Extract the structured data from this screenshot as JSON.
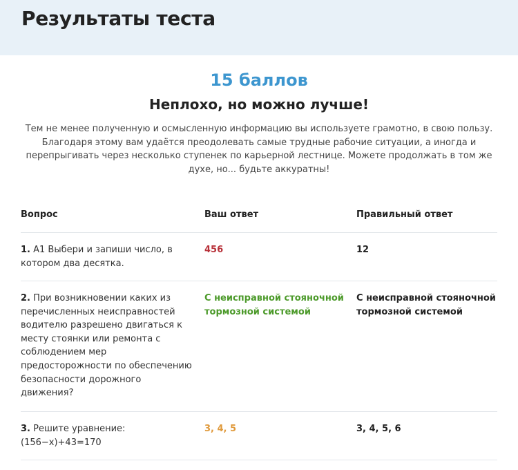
{
  "header": {
    "title": "Результаты теста",
    "bg_color": "#e8f1f8"
  },
  "result": {
    "score": "15 баллов",
    "verdict": "Неплохо, но можно лучше!",
    "description": "Тем не менее полученную и осмысленную информацию вы используете грамотно, в свою пользу. Благодаря этому вам удаётся преодолевать самые трудные рабочие ситуации, а иногда и перепрыгивать через несколько ступенек по карьерной лестнице. Можете продолжать в том же духе, но... будьте аккуратны!",
    "score_color": "#3d96cf"
  },
  "table": {
    "columns": [
      "Вопрос",
      "Ваш ответ",
      "Правильный ответ"
    ],
    "rows": [
      {
        "number": "1.",
        "question": "А1 Выбери и запиши число, в котором два десятка.",
        "your_answer": "456",
        "answer_status": "wrong",
        "correct_answer": "12"
      },
      {
        "number": "2.",
        "question": "При возникновении каких из перечисленных неисправностей водителю разрешено двигаться к месту стоянки или ремонта с соблюдением мер предосторожности по обеспечению безопасности дорожного движения?",
        "your_answer": "С неисправной стояночной тормозной системой",
        "answer_status": "correct",
        "correct_answer": "С неисправной стояночной тормозной системой"
      },
      {
        "number": "3.",
        "question": "Решите уравнение: (156−x)+43=170",
        "your_answer": "3, 4, 5",
        "answer_status": "partial",
        "correct_answer": "3, 4, 5, 6"
      }
    ]
  },
  "status_colors": {
    "wrong": "#b8323a",
    "correct": "#4c9a2a",
    "partial": "#e09a3c"
  }
}
